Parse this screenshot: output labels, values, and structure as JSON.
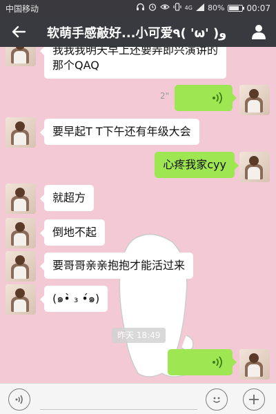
{
  "status_bar": {
    "carrier": "中国移动",
    "network": "4G",
    "battery": "80%",
    "battery_level": 0.8,
    "time": "00:07",
    "icons": [
      "headphones-icon",
      "alarm-icon",
      "eye-icon",
      "vibrate-icon",
      "signal-icon",
      "battery-icon"
    ]
  },
  "header": {
    "title": "软萌手感敲好...小可爱٩( 'ω' )و",
    "back_icon": "arrow-left-icon",
    "profile_icon": "person-icon"
  },
  "messages": [
    {
      "side": "in",
      "type": "text",
      "lines": [
        "我我我明天早上还要弄即兴演讲的",
        "那个QAQ"
      ]
    },
    {
      "side": "out",
      "type": "voice",
      "duration": "2\""
    },
    {
      "side": "in",
      "type": "text",
      "text": "要早起T T下午还有年级大会"
    },
    {
      "side": "out",
      "type": "text",
      "text": "心疼我家cyy"
    },
    {
      "side": "in",
      "type": "text",
      "text": "就超方"
    },
    {
      "side": "in",
      "type": "text",
      "text": "倒地不起"
    },
    {
      "side": "in",
      "type": "text",
      "text": "要哥哥亲亲抱抱才能活过来"
    },
    {
      "side": "in",
      "type": "text",
      "text": "(๑•̀ ₃ •́๑)"
    },
    {
      "side": "out",
      "type": "voice",
      "duration": ""
    }
  ],
  "timestamp": "昨天 18:49",
  "input_bar": {
    "placeholder": "",
    "value": "",
    "voice_icon": "voice-toggle-icon",
    "emoji_icon": "emoji-icon",
    "plus_icon": "plus-icon"
  },
  "colors": {
    "chat_background": "#f4c9d6",
    "outgoing_bubble": "#9ee652",
    "incoming_bubble": "#ffffff",
    "header_background": "#393a3f"
  }
}
